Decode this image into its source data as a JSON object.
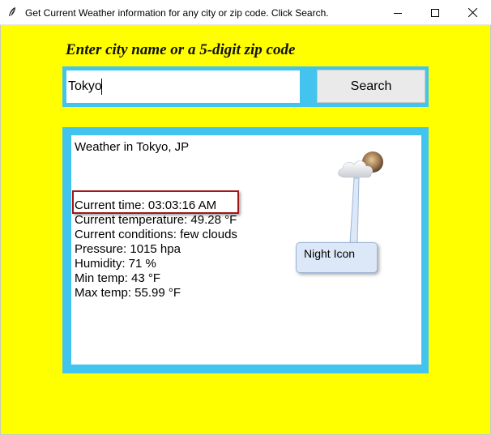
{
  "window": {
    "title": "Get Current Weather information for any city or zip code. Click Search.",
    "icon": "feather-icon",
    "controls": {
      "minimize": "minimize-icon",
      "maximize": "maximize-icon",
      "close": "close-icon"
    }
  },
  "colors": {
    "background": "#ffff00",
    "frame": "#42c4ee",
    "highlight": "#a01818",
    "panel": "#ffffff"
  },
  "prompt": {
    "heading": "Enter city name or a 5-digit zip code"
  },
  "search": {
    "value": "Tokyo",
    "button_label": "Search"
  },
  "weather": {
    "title": "Weather in  Tokyo, JP",
    "current_time": "Current time: 03:03:16 AM",
    "temperature": "Current temperature: 49.28 °F",
    "conditions": "Current conditions: few clouds",
    "pressure": "Pressure: 1015 hpa",
    "humidity": "Humidity: 71 %",
    "min_temp": "Min temp: 43 °F",
    "max_temp": "Max temp: 55.99 °F",
    "icon": "night-cloud-icon"
  },
  "annotation": {
    "callout": "Night Icon"
  }
}
